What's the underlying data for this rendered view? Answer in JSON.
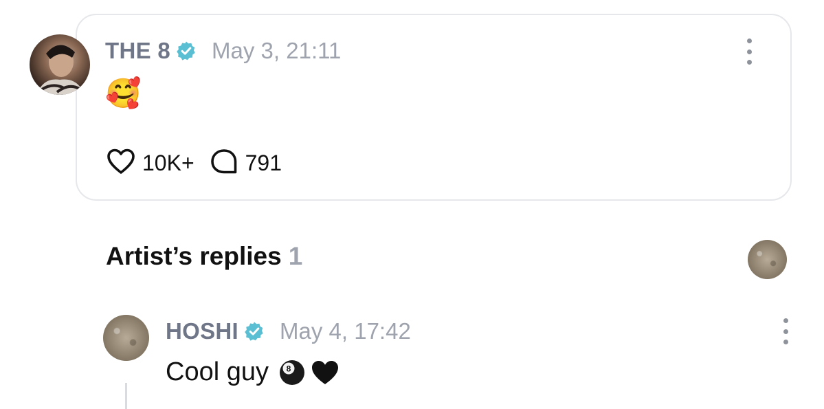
{
  "post": {
    "author": "THE 8",
    "timestamp": "May 3, 21:11",
    "content_emoji": "🥰",
    "likes_count": "10K+",
    "comments_count": "791"
  },
  "artist_replies": {
    "title": "Artist’s replies",
    "count": "1",
    "replies": [
      {
        "author": "HOSHI",
        "timestamp": "May 4, 17:42",
        "text": "Cool guy",
        "emojis": [
          "8-ball-icon",
          "black-heart-icon"
        ]
      }
    ]
  },
  "colors": {
    "name_gray": "#6e7687",
    "time_gray": "#9ea3ad",
    "verified_teal": "#5bbfd3",
    "card_border": "#e6e7ea"
  },
  "icons": {
    "verified": "verified-badge-icon",
    "like": "heart-outline-icon",
    "comment": "speech-bubble-icon",
    "more": "vertical-ellipsis-icon"
  }
}
